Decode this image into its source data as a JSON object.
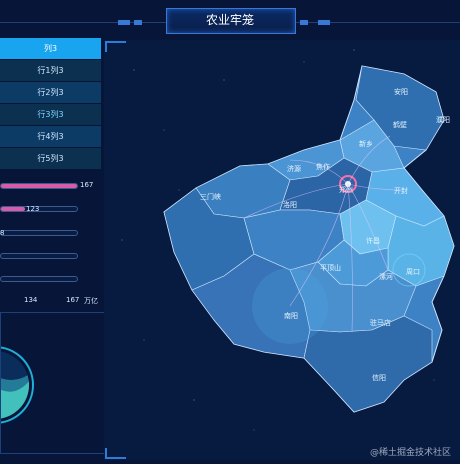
{
  "header": {
    "title": "农业牢笼"
  },
  "table": {
    "header": "列3",
    "rows": [
      "行1列3",
      "行2列3",
      "行3列3",
      "行4列3",
      "行5列3"
    ]
  },
  "bars": {
    "values": [
      {
        "label": "167",
        "value": 167
      },
      {
        "label": "123",
        "value": 123
      },
      {
        "label": "8",
        "value": 8
      },
      {
        "label": "",
        "value": 0
      },
      {
        "label": "",
        "value": 0
      }
    ],
    "max": 167,
    "axis_ticks": [
      "134",
      "167"
    ],
    "unit": "万亿"
  },
  "map": {
    "cities": [
      "安阳",
      "鹤壁",
      "濮阳",
      "新乡",
      "焦作",
      "济源",
      "三门峡",
      "洛阳",
      "郑州",
      "开封",
      "许昌",
      "平顶山",
      "漯河",
      "周口",
      "南阳",
      "驻马店",
      "信阳"
    ]
  },
  "watermark": "@稀土掘金技术社区",
  "colors": {
    "bar": "#d85aa8",
    "selected_row": "#19a4f0",
    "map_fill": "#3d82c4"
  }
}
